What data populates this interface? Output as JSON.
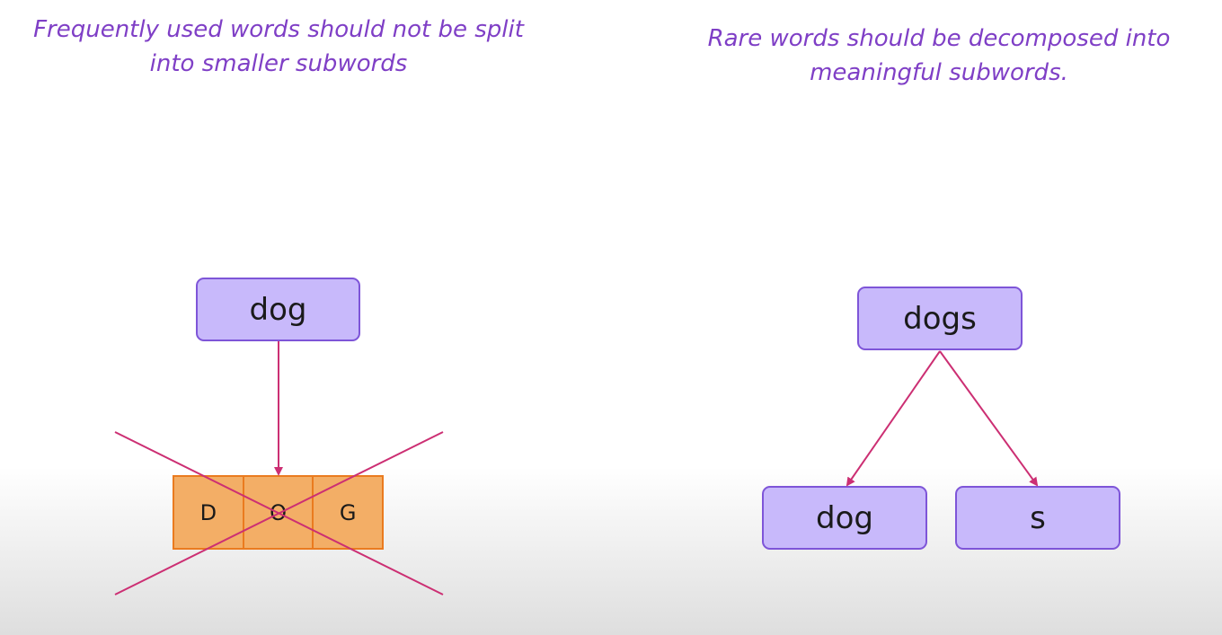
{
  "left_caption": {
    "line1": "Frequently used words should not be split",
    "line2": "into smaller subwords"
  },
  "right_caption": {
    "line1": "Rare words should be decomposed into",
    "line2": "meaningful subwords."
  },
  "left_diagram": {
    "word": "dog",
    "characters": [
      "D",
      "O",
      "G"
    ]
  },
  "right_diagram": {
    "word": "dogs",
    "subwords": [
      "dog",
      "s"
    ]
  },
  "colors": {
    "caption": "#7f3fc6",
    "word_box_fill": "#c8b9fb",
    "word_box_border": "#7e55d8",
    "char_fill": "#f3ae66",
    "char_border": "#ea7b1f",
    "arrow": "#cc2f73"
  }
}
